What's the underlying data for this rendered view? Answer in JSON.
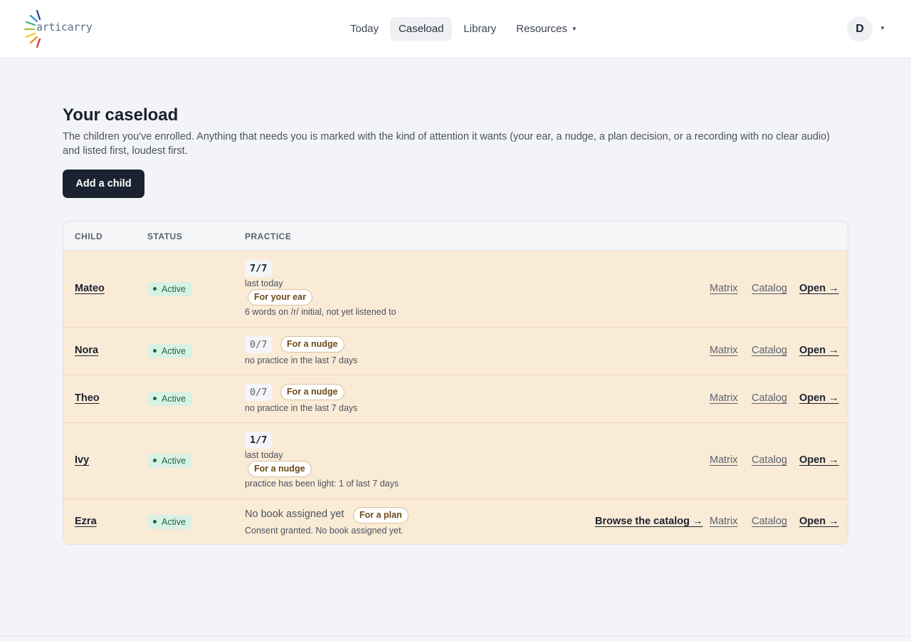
{
  "app": {
    "logo_text": "articarry",
    "user_initial": "D"
  },
  "nav": {
    "items": [
      "Today",
      "Caseload",
      "Library",
      "Resources"
    ],
    "active": "Caseload"
  },
  "page": {
    "title": "Your caseload",
    "description": "The children you've enrolled. Anything that needs you is marked with the kind of attention it wants (your ear, a nudge, a plan decision, or a recording with no clear audio) and listed first, loudest first.",
    "add_button": "Add a child"
  },
  "table": {
    "headers": [
      "CHILD",
      "STATUS",
      "PRACTICE"
    ],
    "rows": [
      {
        "name": "Mateo",
        "status": "Active",
        "count": "7/7",
        "last": "last today",
        "tag": "For your ear",
        "note": "6 words on /r/ initial, not yet listened to",
        "actions": [
          "Matrix",
          "Catalog",
          "Open →"
        ]
      },
      {
        "name": "Nora",
        "status": "Active",
        "count": "0/7",
        "tag": "For a nudge",
        "note": "no practice in the last 7 days",
        "actions": [
          "Matrix",
          "Catalog",
          "Open →"
        ]
      },
      {
        "name": "Theo",
        "status": "Active",
        "count": "0/7",
        "tag": "For a nudge",
        "note": "no practice in the last 7 days",
        "actions": [
          "Matrix",
          "Catalog",
          "Open →"
        ]
      },
      {
        "name": "Ivy",
        "status": "Active",
        "count": "1/7",
        "last": "last today",
        "tag": "For a nudge",
        "note": "practice has been light: 1 of last 7 days",
        "actions": [
          "Matrix",
          "Catalog",
          "Open →"
        ]
      },
      {
        "name": "Ezra",
        "status": "Active",
        "nobook": "No book assigned yet",
        "tag": "For a plan",
        "note": "Consent granted. No book assigned yet.",
        "browse": "Browse the catalog →",
        "actions": [
          "Matrix",
          "Catalog",
          "Open →"
        ]
      }
    ]
  },
  "colors": {
    "attention_row_bg": "#faebd6",
    "active_badge_bg": "#d9f1e4",
    "primary_button_bg": "#1b2230"
  }
}
